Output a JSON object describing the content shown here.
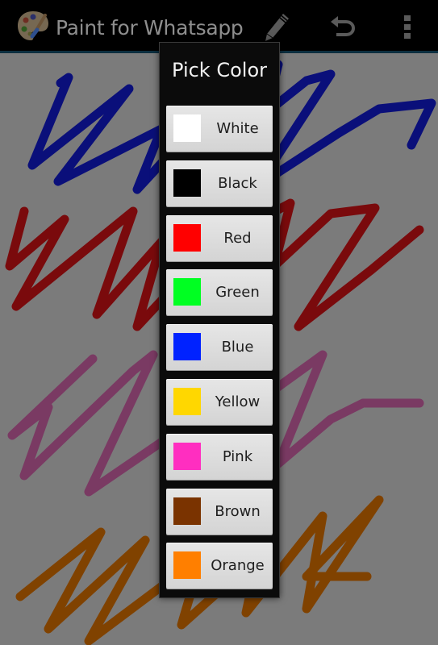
{
  "action_bar": {
    "title": "Paint for Whatsapp",
    "app_icon": "palette-icon",
    "actions": [
      {
        "name": "pencil",
        "icon": "pencil-icon"
      },
      {
        "name": "undo",
        "icon": "undo-icon"
      },
      {
        "name": "overflow",
        "icon": "overflow-menu-icon"
      }
    ]
  },
  "canvas": {
    "background": "#7b7b7b",
    "strokes": [
      {
        "name": "blue-scribble",
        "color": "#0a0f7a"
      },
      {
        "name": "red-scribble",
        "color": "#7a0a0c"
      },
      {
        "name": "pink-scribble",
        "color": "#7a3a63"
      },
      {
        "name": "orange-scribble",
        "color": "#804200"
      }
    ]
  },
  "dialog": {
    "title": "Pick Color",
    "colors": [
      {
        "label": "White",
        "swatch": "#ffffff"
      },
      {
        "label": "Black",
        "swatch": "#000000"
      },
      {
        "label": "Red",
        "swatch": "#ff0000"
      },
      {
        "label": "Green",
        "swatch": "#00ff22"
      },
      {
        "label": "Blue",
        "swatch": "#0022ff"
      },
      {
        "label": "Yellow",
        "swatch": "#ffd700"
      },
      {
        "label": "Pink",
        "swatch": "#ff2ec0"
      },
      {
        "label": "Brown",
        "swatch": "#7a3300"
      },
      {
        "label": "Orange",
        "swatch": "#ff7f00"
      }
    ]
  }
}
